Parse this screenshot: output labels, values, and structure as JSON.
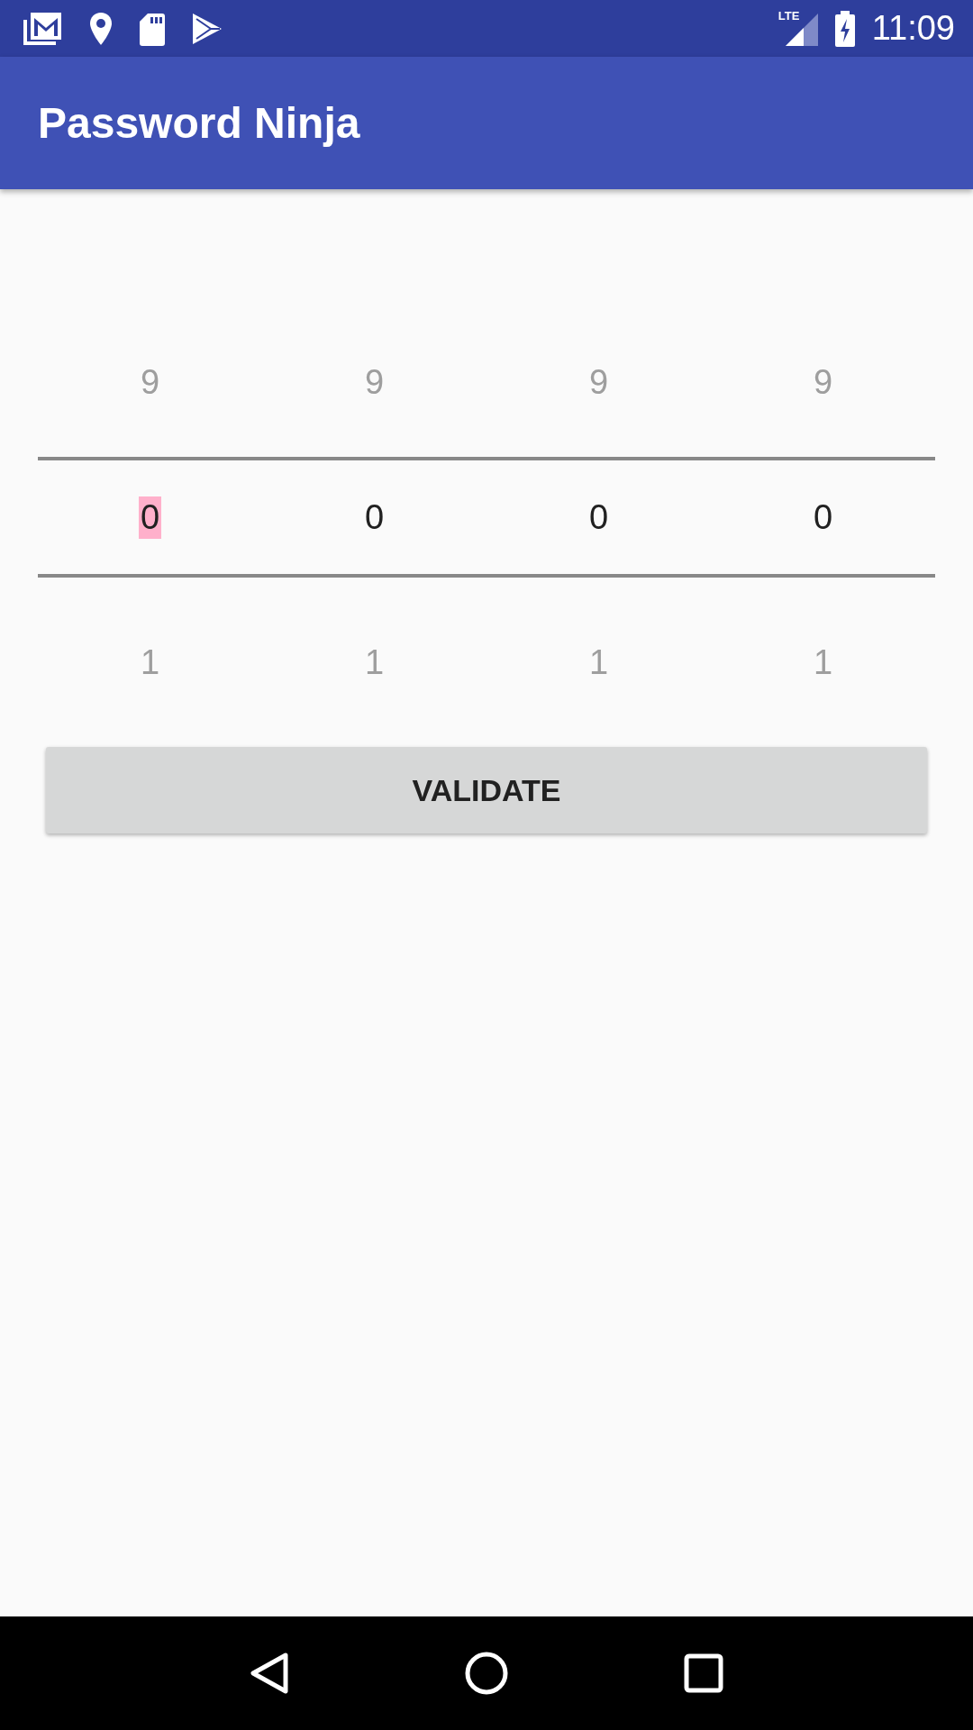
{
  "status_bar": {
    "network": "LTE",
    "time": "11:09"
  },
  "app_bar": {
    "title": "Password Ninja"
  },
  "pickers": [
    {
      "above": "9",
      "value": "0",
      "below": "1",
      "selected": true
    },
    {
      "above": "9",
      "value": "0",
      "below": "1",
      "selected": false
    },
    {
      "above": "9",
      "value": "0",
      "below": "1",
      "selected": false
    },
    {
      "above": "9",
      "value": "0",
      "below": "1",
      "selected": false
    }
  ],
  "button": {
    "label": "VALIDATE"
  }
}
